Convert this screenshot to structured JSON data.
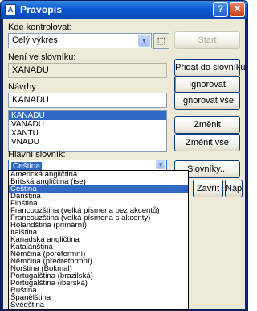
{
  "window": {
    "title": "Pravopis",
    "help": "?",
    "close": "✕"
  },
  "check_in": {
    "label": "Kde kontrolovat:",
    "value": "Celý výkres",
    "icon": "pointer-select-icon"
  },
  "buttons": {
    "start": "Start",
    "add_to_dictionary": "Přidat do slovníku",
    "ignore": "Ignorovat",
    "ignore_all": "Ignorovat vše",
    "change": "Změnit",
    "change_all": "Změnit vše",
    "dictionaries": "Slovníky...",
    "close": "Zavřít",
    "help": "Nápověda"
  },
  "not_in_dictionary": {
    "label": "Není ve slovníku:",
    "value": "XANADU"
  },
  "suggestions": {
    "label": "Návrhy:",
    "value": "KANADU",
    "items": [
      "KANADU",
      "VANADU",
      "XANTU",
      "VNADU"
    ],
    "selected_index": 0
  },
  "main_dictionary": {
    "label": "Hlavní slovník:",
    "value": "Čeština",
    "options": [
      "Americká angličtina",
      "Britská angličtina (ise)",
      "Čeština",
      "Dánština",
      "Finština",
      "Francouzština (velká písmena bez akcentů)",
      "Francouzština (velká písmena s akcenty)",
      "Holandština (primární)",
      "Italština",
      "Kanadská angličtina",
      "Katalánština",
      "Němčina (poreformní)",
      "Němčina (předreformní)",
      "Norština (Bokmal)",
      "Portugalština (brazilská)",
      "Portugalština (iberská)",
      "Ruština",
      "Španělština",
      "Švédština"
    ],
    "selected_index": 2
  },
  "colors": {
    "selection": "#316ac5",
    "dialog_bg": "#ece9d8",
    "title_blue": "#0a5ad4"
  }
}
